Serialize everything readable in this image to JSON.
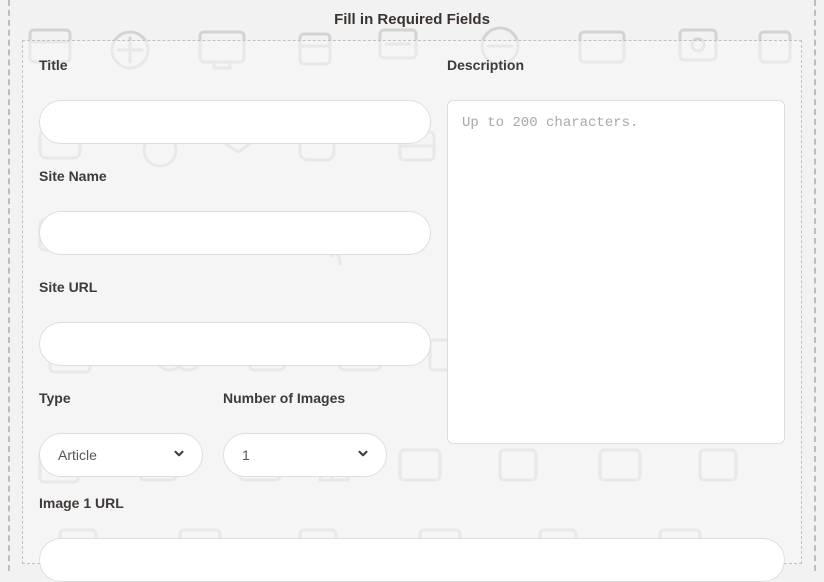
{
  "heading": "Fill in Required Fields",
  "left": {
    "title": {
      "label": "Title",
      "value": ""
    },
    "siteName": {
      "label": "Site Name",
      "value": ""
    },
    "siteUrl": {
      "label": "Site URL",
      "value": ""
    },
    "type": {
      "label": "Type",
      "selected": "Article"
    },
    "numImages": {
      "label": "Number of Images",
      "selected": "1"
    }
  },
  "right": {
    "description": {
      "label": "Description",
      "placeholder": "Up to 200 characters.",
      "value": ""
    }
  },
  "image1": {
    "label": "Image 1 URL",
    "value": ""
  }
}
